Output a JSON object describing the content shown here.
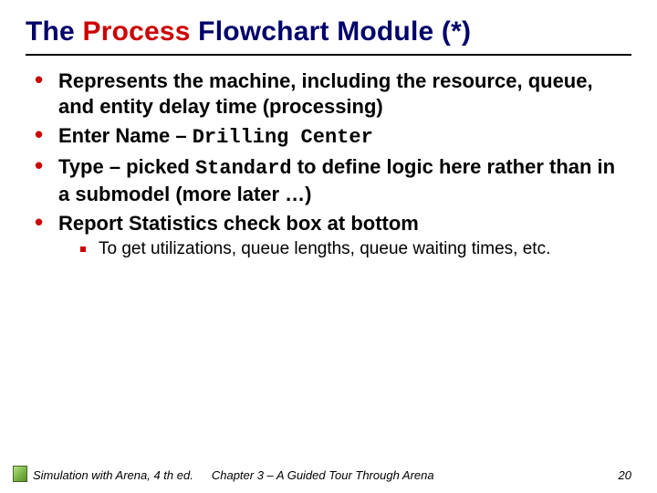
{
  "title": {
    "pre": "The ",
    "accent": "Process",
    "post": " Flowchart Module (*)"
  },
  "bullets": {
    "b1": "Represents the machine, including the resource, queue, and entity delay time (processing)",
    "b2_pre": "Enter Name – ",
    "b2_code": "Drilling Center",
    "b3_pre": "Type – picked ",
    "b3_code": "Standard",
    "b3_post": " to define logic here rather than in a submodel (more later …)",
    "b4": "Report Statistics check box at bottom",
    "b4_sub": "To get utilizations, queue lengths, queue waiting times, etc."
  },
  "footer": {
    "book": "Simulation with Arena, 4 th ed.",
    "chapter": "Chapter 3 – A Guided Tour Through Arena",
    "page": "20"
  }
}
